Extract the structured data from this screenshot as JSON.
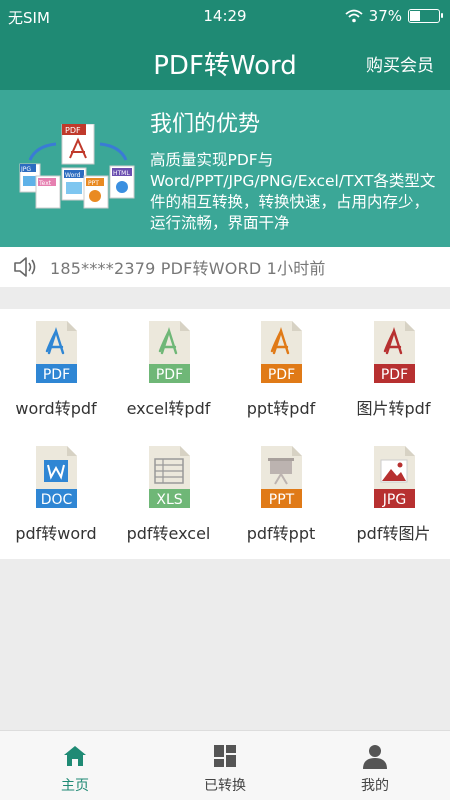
{
  "status_bar": {
    "carrier": "无SIM",
    "time": "14:29",
    "battery": "37%",
    "battery_level": 0.37
  },
  "nav": {
    "title": "PDF转Word",
    "right_action": "购买会员"
  },
  "banner": {
    "heading": "我们的优势",
    "description": "高质量实现PDF与Word/PPT/JPG/PNG/Excel/TXT各类型文件的相互转换，转换快速，占用内存少，运行流畅，界面干净",
    "art_labels": [
      "PDF",
      "JPG",
      "Text",
      "Word",
      "PPT",
      "HTML"
    ]
  },
  "notice": {
    "text": "185****2379  PDF转WORD  1小时前"
  },
  "tools": [
    {
      "label": "word转pdf",
      "badge": "PDF",
      "color": "#2f86d4",
      "icon": "pdf-file-icon"
    },
    {
      "label": "excel转pdf",
      "badge": "PDF",
      "color": "#6fb777",
      "icon": "pdf-file-icon"
    },
    {
      "label": "ppt转pdf",
      "badge": "PDF",
      "color": "#e07a17",
      "icon": "pdf-file-icon"
    },
    {
      "label": "图片转pdf",
      "badge": "PDF",
      "color": "#b73030",
      "icon": "pdf-file-icon"
    },
    {
      "label": "pdf转word",
      "badge": "DOC",
      "color": "#2f86d4",
      "icon": "doc-file-icon"
    },
    {
      "label": "pdf转excel",
      "badge": "XLS",
      "color": "#6fb777",
      "icon": "xls-file-icon"
    },
    {
      "label": "pdf转ppt",
      "badge": "PPT",
      "color": "#e07a17",
      "icon": "ppt-file-icon"
    },
    {
      "label": "pdf转图片",
      "badge": "JPG",
      "color": "#b73030",
      "icon": "jpg-file-icon"
    }
  ],
  "tabs": [
    {
      "label": "主页",
      "icon": "home-icon",
      "active": true
    },
    {
      "label": "已转换",
      "icon": "grid-icon",
      "active": false
    },
    {
      "label": "我的",
      "icon": "person-icon",
      "active": false
    }
  ],
  "colors": {
    "primary": "#1f8a74",
    "banner": "#3ba797",
    "active_tab": "#1f8a74"
  }
}
